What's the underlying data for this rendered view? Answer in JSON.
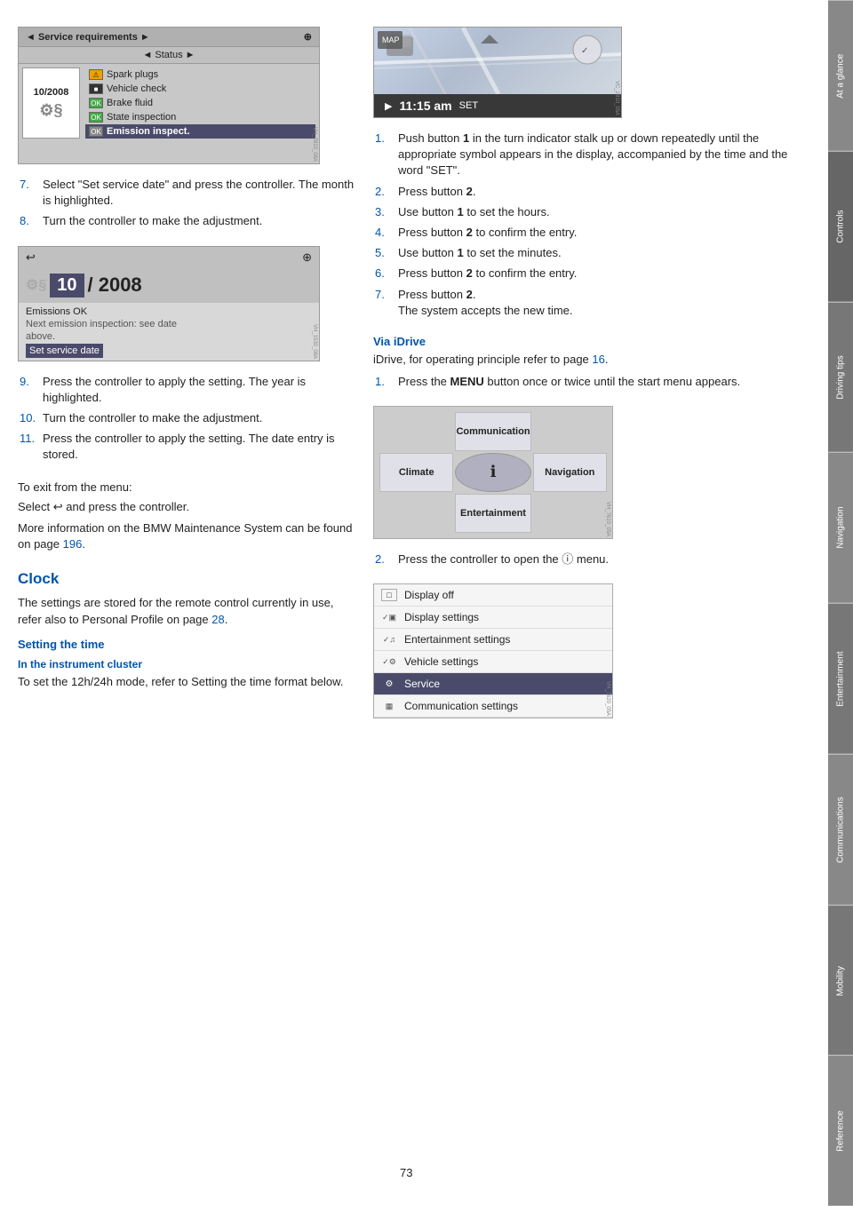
{
  "page": {
    "number": "73",
    "background": "#ffffff"
  },
  "side_tabs": [
    {
      "label": "At a glance",
      "active": false
    },
    {
      "label": "Controls",
      "active": true
    },
    {
      "label": "Driving tips",
      "active": false
    },
    {
      "label": "Navigation",
      "active": false
    },
    {
      "label": "Entertainment",
      "active": false
    },
    {
      "label": "Communications",
      "active": false
    },
    {
      "label": "Mobility",
      "active": false
    },
    {
      "label": "Reference",
      "active": false
    }
  ],
  "left_column": {
    "service_screen": {
      "header": "◄  Service requirements  ►",
      "settings_icon": "⊕",
      "status": "◄  Status  ►",
      "date": "10/2008",
      "items": [
        {
          "icon": "⚠",
          "icon_type": "warn",
          "text": "Spark plugs"
        },
        {
          "icon": "■",
          "icon_type": "dark",
          "text": "Vehicle check"
        },
        {
          "icon": "OK",
          "icon_type": "ok",
          "text": "Brake fluid"
        },
        {
          "icon": "OK",
          "icon_type": "ok",
          "text": "State inspection"
        },
        {
          "icon": "OK",
          "icon_type": "ok",
          "text": "Emission inspect.",
          "selected": true
        }
      ]
    },
    "steps_1": [
      {
        "num": "7.",
        "color": "blue",
        "text": "Select \"Set service date\" and press the controller. The month is highlighted."
      },
      {
        "num": "8.",
        "color": "blue",
        "text": "Turn the controller to make the adjustment."
      }
    ],
    "date_edit_screen": {
      "back_icon": "↩",
      "settings_icon": "⊕",
      "car_icon": "§",
      "month": "10",
      "slash": "/ 2008",
      "info1": "Emissions OK",
      "info2": "Next emission inspection: see date",
      "info3": "above.",
      "info4": "Set service date"
    },
    "steps_2": [
      {
        "num": "9.",
        "color": "blue",
        "text": "Press the controller to apply the setting. The year is highlighted."
      },
      {
        "num": "10.",
        "color": "blue",
        "text": "Turn the controller to make the adjustment."
      },
      {
        "num": "11.",
        "color": "blue",
        "text": "Press the controller to apply the setting. The date entry is stored."
      }
    ],
    "exit_text": "To exit from the menu:",
    "exit_text2": "Select ↩ and press the controller.",
    "more_info": "More information on the BMW Maintenance System can be found on page ",
    "more_info_page": "196",
    "more_info_end": ".",
    "clock_section": {
      "title": "Clock",
      "body": "The settings are stored for the remote control currently in use, refer also to Personal Profile on page ",
      "body_page": "28",
      "body_end": ".",
      "setting_time_title": "Setting the time",
      "in_cluster_title": "In the instrument cluster",
      "in_cluster_text": "To set the 12h/24h mode, refer to Setting the time format below."
    }
  },
  "right_column": {
    "clock_screen": {
      "time": "11:15 am",
      "set_label": "SET",
      "play_icon": "▶"
    },
    "steps_right": [
      {
        "num": "1.",
        "color": "blue",
        "text": "Push button 1 in the turn indicator stalk up or down repeatedly until the appropriate symbol appears in the display, accompanied by the time and the word \"SET\"."
      },
      {
        "num": "2.",
        "color": "blue",
        "text": "Press button 2."
      },
      {
        "num": "3.",
        "color": "blue",
        "text": "Use button 1 to set the hours."
      },
      {
        "num": "4.",
        "color": "blue",
        "text": "Press button 2 to confirm the entry."
      },
      {
        "num": "5.",
        "color": "blue",
        "text": "Use button 1 to set the minutes."
      },
      {
        "num": "6.",
        "color": "blue",
        "text": "Press button 2 to confirm the entry."
      },
      {
        "num": "7.",
        "color": "blue",
        "text": "Press button 2.",
        "extra": "The system accepts the new time."
      }
    ],
    "via_idrive": {
      "title": "Via iDrive",
      "intro": "iDrive, for operating principle refer to page ",
      "intro_page": "16",
      "intro_end": ".",
      "step1": "Press the MENU button once or twice until the start menu appears.",
      "step2_text": "Press the controller to open the",
      "step2_icon": "ⓘ",
      "step2_end": "menu."
    },
    "idrive_menu": {
      "top": "Communication",
      "left": "Climate",
      "center_icon": "ⓘ",
      "right": "Navigation",
      "bottom": "Entertainment"
    },
    "service_menu": {
      "items": [
        {
          "icon": "□",
          "text": "Display off",
          "highlighted": false
        },
        {
          "icon": "✓",
          "text": "Display settings",
          "highlighted": false
        },
        {
          "icon": "✓",
          "text": "Entertainment settings",
          "highlighted": false
        },
        {
          "icon": "✓",
          "text": "Vehicle settings",
          "highlighted": false
        },
        {
          "icon": "⚙",
          "text": "Service",
          "highlighted": true
        },
        {
          "icon": "▦",
          "text": "Communication settings",
          "highlighted": false
        }
      ]
    }
  }
}
